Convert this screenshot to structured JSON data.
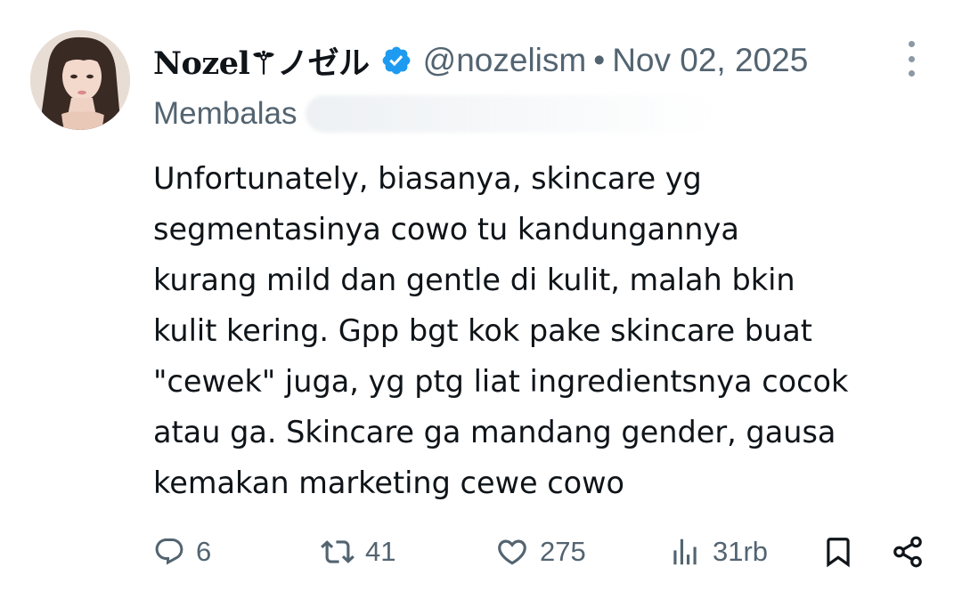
{
  "tweet": {
    "display_name": "Nozel⚚ノゼル",
    "handle": "@nozelism",
    "separator": "•",
    "date": "Nov 02, 2025",
    "reply_label": "Membalas",
    "reply_target": "",
    "text": "Unfortunately, biasanya, skincare yg\nsegmentasinya cowo tu kandungannya\nkurang mild dan gentle di kulit, malah bkin\nkulit kering. Gpp bgt kok pake skincare buat\n\"cewek\" juga, yg ptg liat ingredientsnya cocok\natau ga. Skincare ga mandang gender, gausa\nkemakan marketing cewe cowo"
  },
  "actions": {
    "reply_count": "6",
    "repost_count": "41",
    "like_count": "275",
    "views_count": "31rb"
  },
  "icons": {
    "verified": "verified-badge-icon",
    "more": "more-options-icon",
    "reply": "reply-icon",
    "repost": "repost-icon",
    "like": "heart-icon",
    "views": "views-icon",
    "bookmark": "bookmark-icon",
    "share": "share-icon"
  },
  "colors": {
    "verified_blue": "#1d9bf0",
    "muted_text": "#536471",
    "main_text": "#0f1419"
  }
}
